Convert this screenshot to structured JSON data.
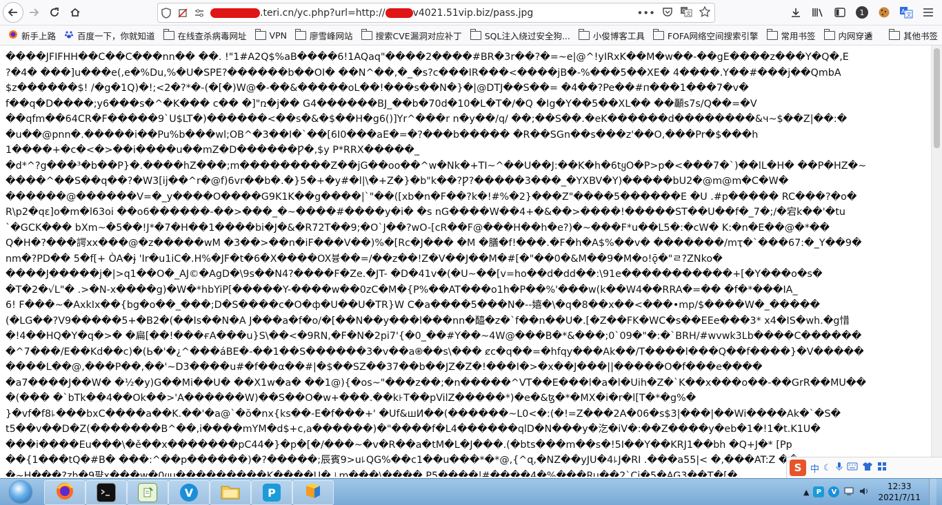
{
  "browser": {
    "url_prefix": "",
    "url_middle": ".teri.cn/yc.php?url=http://",
    "url_suffix": "v4021.51vip.biz/pass.jpg",
    "icons": [
      "back-icon",
      "forward-icon",
      "reload-icon",
      "home-icon",
      "shield-icon",
      "tracking-protection-icon",
      "permissions-icon",
      "more-icon",
      "pocket-icon",
      "translate-icon",
      "bookmark-star-icon",
      "download-icon",
      "library-icon",
      "sidebar-icon",
      "extension-count-icon",
      "cookie-icon",
      "translate-ext-icon",
      "menu-icon"
    ],
    "extension_count": "1"
  },
  "bookmarks": {
    "items": [
      {
        "label": "新手上路",
        "icon": "firefox-icon"
      },
      {
        "label": "百度一下，你就知道",
        "icon": "baidu-icon"
      },
      {
        "label": "在线查杀病毒网址",
        "icon": "folder-icon"
      },
      {
        "label": "VPN",
        "icon": "folder-icon"
      },
      {
        "label": "廖雪峰网站",
        "icon": "folder-icon"
      },
      {
        "label": "搜索CVE漏洞对应补丁",
        "icon": "folder-icon"
      },
      {
        "label": "SQL注入绕过安全狗...",
        "icon": "folder-icon"
      },
      {
        "label": "小俊博客工具",
        "icon": "folder-icon"
      },
      {
        "label": "FOFA网络空间搜索引擎",
        "icon": "folder-icon"
      },
      {
        "label": "常用书签",
        "icon": "folder-icon"
      },
      {
        "label": "内网穿透",
        "icon": "folder-icon"
      }
    ],
    "overflow": "»",
    "other": "其他书签"
  },
  "content": {
    "lines": [
      "����JFIFHH��C��C���nn��  ��. !\"1#A2Q$%aB����6!1AQaq\"����2����#BR�3r��?�=~e|@^!yIRxK��M�w��-��gE����z���Y�Q�,E",
      "?�4� ���]u���e(,e�%Du,%�U�SPE?������b��OI� ��N^��,�_�s?c���IR���<����jB�-%���5��XE� 4����.Y��#���j��QmbA",
      "$z������$! /�g�1Q)�!;<2�?*�-(�[�)W@�-��&�����oL��!���s��N�}�|@DTJ��S��= �4��?Pe��#п���1���7�v�",
      "f��q�D����;y6���s�^�K��� c�� �]\"ռ�j�� G4������BJ_��b�70d�10�L�T�/�Q �Ig�Y��5��XL�� ��顳s7s/Q��=�V",
      "��qfm��64CR�F�����9`U$LT�)������<��s�&�$��H�g6()]Yr^���r n�y��/q/ ��;��S��.�eK������d��������&ч~$��Z|��:�",
      "�u��@pnn�.�����i��Pu%b���wl;OB^�3��I�`��[6I0���aE�=�?���b����� �R��SGn��s���z'��O,���Pr�$���h",
      "1����+�c�<�>��i����u��mZ�D������Ƿ�,$y P*RRX�����_",
      "�d*^?g���³�b��P}�.����hZ���;m���������Z��jG��oo��^w�Nk�+TI~^��U��J:��K�h�6tყO�P>p�<���7�`)��lL�H� ��P�HZ�~",
      "����^��S��q��?�W3[ij��^r�@f)6vr��b�.�}5�+�y#�l|\\�+Z�}�b\"k��?Ƿ?�����3���_�YXBV�Y)�����bU2�@m@m�C�W�",
      "������@������V=�_y����O����G9K1K��g����|`\"��([xb�n�F��?k�!#%�2}���Z\"����5������E �U .#p����� RC���?�o�",
      "R\\p2�qɛ]o�m�l63oi ��o6������-��>���_�~����#����y�i� �s nG����W��4+�&��>����!�����ST��U��f�_7�;/�宕k��'�tu",
      "`�GCK��� bXm~�5��!J*�7�H��1����bi�J�&�R72T��9;�O`J��?wO-[cR��F@���H��h�e?)�~���F*u��L5�:�cW� K:�n�E��@�*��",
      "Q�H�?���諤xx���@�z�����wM �3��>��n�iF���V��)%�[Rc�J��� �M �膳�f!���.�F�h�A$%��v� �������/mҭ�`���67:�_Y��9�",
      "nm�?PD�� 5�f[+ ÒA�ɉ 'Ir�u1iC�.H%�JF�t�6�X����OX븅��=/��z��!Z�V��J��M�#[�\"��0�&M��9�M�o!ǭ�\"ㄹ?ZNko�",
      "����J�����j�|>q1��O�_AJ©�AgD�\\9s��N4?����F�Ze.�JT- �D�41v�(�U~��[v=ho��d�dd��:\\91e�����������+[�Y���o�s�",
      "�T�2�√L\"� .>�N-x����g)�W�*hbYiP[�����Y-����w��0zC�M�{P%��AT���o1h�P��%'���w(k��W4��RRA�=�� �f�*���IA_",
      "6! F���~�AxkIx��{bg�o��_���;D�S����c�O�ф�U��U�TR}W C�a����5���N�--嬉�\\�q�8��x��<���•mp/$����W�_�����",
      "(�LG��?V9�����5+�B2�(��Is��N�A J���a�f�o/�[��N��y���l���nn�醯�z�`f��n��U�.[�Z��FK�WC�s��EEe���3* x4�IS�wh.�g惜",
      "�!4��HQ�Y�q�>� �扁[��!���ғA���u}S\\��<�9RN,�F�N�2pi7'{�0_��#Y��~4W@���B�*&���;0`09�\"�:�`BRH/#wvwk3Lb����C������",
      "�^7���/E��Kd��c)�(Ь�'�¿^���áBE�-��1��S������3�v��a֎��s\\��� ȼc�q��=�hfqy���Ak��/T����l���Q��f����}�V�����",
      "����L��@,���P��,��'~D3����u#�f��α��#|�$��SZ��37��b��JZ�Z�!���I�>�x��J���||�����O�f���e����",
      "�a7����J��W� �½�y)G��Mi��U� ��X1w�a� ��1@){�os~\"���z��;�n�����^VT��E���l�a�l�Uih�Z�`K��x���o��-��GrR��MU��",
      "�(��� �`bTk��4��Ok��>'A������W)��S��O�w+���.��k꜔T��pVilZ�����*)�e�&ꜩ�*�MX�i�r�l[T�*�g%�",
      "}�vf�f8꜕���bxC����a��K.��'�a@`�ŏ�nx{ks��-E�f���+' �Uf&шИ��(������~L0<�:(�!=Z���2A�06�s$3|���|��Wi����Ak�`�S�",
      "t5��v��D�Z(�������B^��,i����mYM�d$+c,a������)�\"����f�L4������qlD�N���y�汔�iV�:��Z����y�eb�1�!1�t.K1U�",
      "���i����Eu���\\�ě��x�������pC44�}�p�[�/���~�v�R��a�tM�L�J���.(�bts���m��s�!5I��Y��KRJ1��bh �Q+J�* [Pp",
      "��{1���tQ�#B� ���:^��p������)�?�����;辰賓9>u꜕QG%��c1��u���*�*@,{^ɋ,�NZ��yJU�4꜕J�RI .���a55|< �,���AT:Z ��",
      "�~H���?zh�9퍔x���w�0ყu���������K����U� ꜕m���\\����,P5����|#����4�%���Ru��2`Ci�5�AG3��T�[�"
    ]
  },
  "taskbar": {
    "apps": [
      "firefox-icon",
      "terminal-icon",
      "notepad-plus-icon",
      "vmware-icon",
      "explorer-icon",
      "pycharm-icon",
      "sublime-icon"
    ],
    "time": "12:33",
    "date": "2021/7/11"
  },
  "ime": {
    "lang": "中",
    "icons": [
      "sogou-icon",
      "moon-icon",
      "mic-icon",
      "keyboard-icon",
      "shirt-icon",
      "grid-icon"
    ]
  }
}
